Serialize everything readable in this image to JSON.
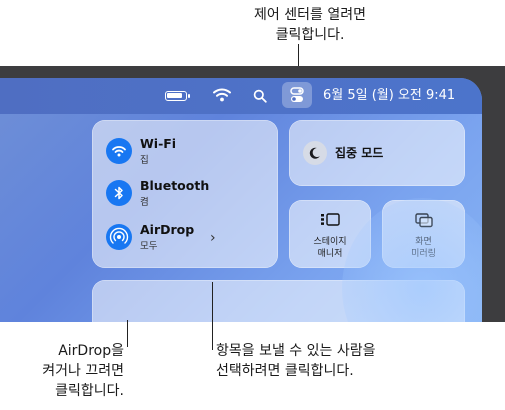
{
  "callouts": {
    "top": "제어 센터를 열려면\n클릭합니다.",
    "airdrop": "AirDrop을\n켜거나 끄려면\n클릭합니다.",
    "share": "항목을 보낼 수 있는 사람을\n선택하려면 클릭합니다."
  },
  "menubar": {
    "datetime": "6월 5일 (월) 오전 9:41",
    "icons": [
      "battery-icon",
      "wifi-icon",
      "search-icon",
      "control-center-icon"
    ]
  },
  "control_center": {
    "wifi": {
      "name": "Wi-Fi",
      "status": "집"
    },
    "bluetooth": {
      "name": "Bluetooth",
      "status": "켬"
    },
    "airdrop": {
      "name": "AirDrop",
      "status": "모두"
    },
    "focus": {
      "label": "집중 모드"
    },
    "stage_manager": {
      "label": "스테이지\n매니저"
    },
    "screen_mirroring": {
      "label": "화면\n미러링"
    }
  },
  "colors": {
    "accent_blue": "#1877f2",
    "desktop_blue": "#6f8fd6",
    "bezel": "#3d3d3f"
  }
}
